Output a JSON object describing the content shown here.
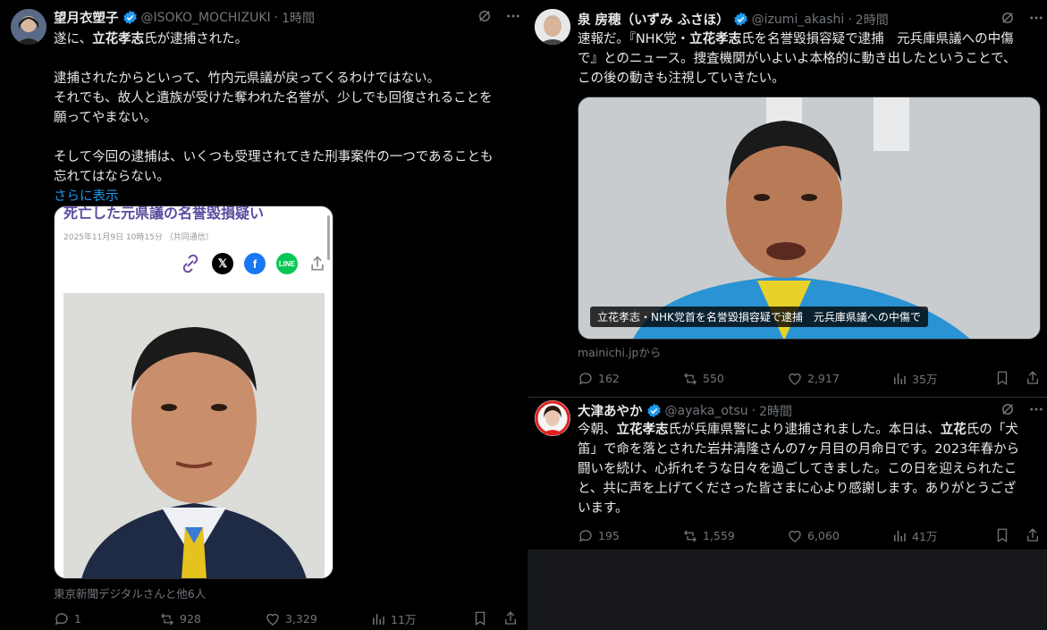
{
  "post1": {
    "name": "望月衣塑子",
    "handle": "@ISOKO_MOCHIZUKI",
    "dot": "·",
    "time": "1時間",
    "line1_pre": "遂に、",
    "line1_bold": "立花孝志",
    "line1_post": "氏が逮捕された。",
    "para2": "逮捕されたからといって、竹内元県議が戻ってくるわけではない。\nそれでも、故人と遺族が受けた奪われた名誉が、少しでも回復されることを\n願ってやまない。",
    "para3": "そして今回の逮捕は、いくつも受理されてきた刑事案件の一つであることも\n忘れてはならない。",
    "more": "さらに表示",
    "card": {
      "headline": "死亡した元県議の名誉毀損疑い",
      "date": "2025年11月9日 10時15分 （共同通信）"
    },
    "source": "東京新聞デジタルさんと他6人",
    "replies": "1",
    "reposts": "928",
    "likes": "3,329",
    "views": "11万"
  },
  "post2": {
    "name": "泉 房穂（いずみ ふさほ）",
    "handle": "@izumi_akashi",
    "dot": "·",
    "time": "2時間",
    "t1": "速報だ。『NHK党・",
    "t1_bold": "立花孝志",
    "t1_post": "氏を名誉毀損容疑で逮捕　元兵庫県議への中傷",
    "t2": "で』とのニュース。捜査機関がいよいよ本格的に動き出したということで、\nこの後の動きも注視していきたい。",
    "card_caption": "立花孝志・NHK党首を名誉毀損容疑で逮捕　元兵庫県議への中傷で",
    "source": "mainichi.jpから",
    "replies": "162",
    "reposts": "550",
    "likes": "2,917",
    "views": "35万"
  },
  "post3": {
    "name": "大津あやか",
    "handle": "@ayaka_otsu",
    "dot": "·",
    "time": "2時間",
    "a1": "今朝、",
    "a1_bold": "立花孝志",
    "a1_post": "氏が兵庫県警により逮捕されました。本日は、",
    "a2_bold": "立花",
    "a2_post": "氏の「犬",
    "rest": "笛」で命を落とされた岩井清隆さんの7ヶ月目の月命日です。2023年春から\n闘いを続け、心折れそうな日々を過ごしてきました。この日を迎えられたこ\nと、共に声を上げてくださった皆さまに心より感謝します。ありがとうござ\nいます。",
    "replies": "195",
    "reposts": "1,559",
    "likes": "6,060",
    "views": "41万"
  },
  "colors": {
    "accent": "#1d9bf0",
    "bg": "#000000",
    "muted": "#71767b"
  }
}
